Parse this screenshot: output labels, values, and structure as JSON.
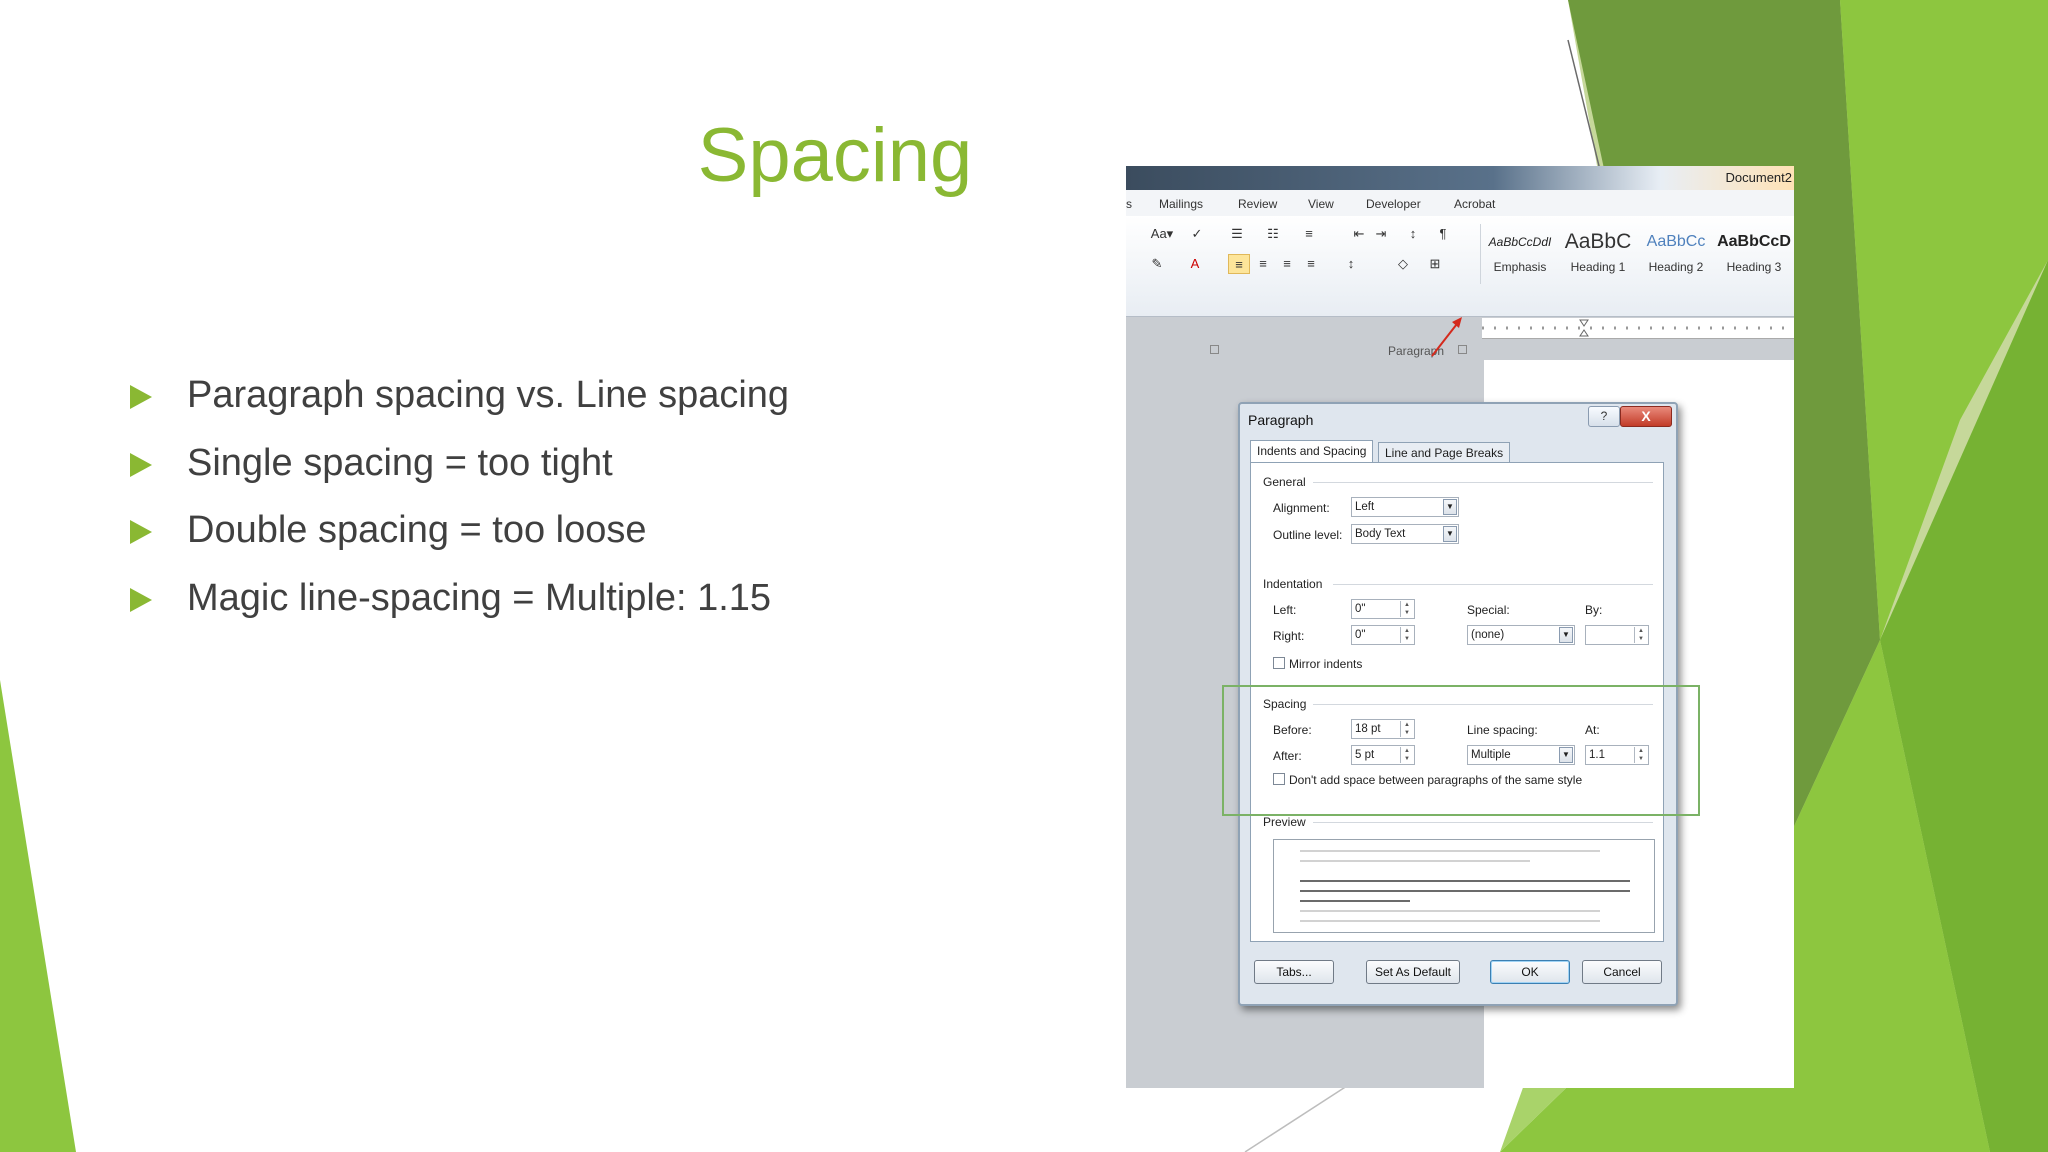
{
  "slide": {
    "title": "Spacing",
    "bullets": [
      "Paragraph spacing vs. Line spacing",
      "Single spacing = too tight",
      "Double spacing = too loose",
      "Magic line-spacing = Multiple: 1.15"
    ],
    "accent_color": "#8ab833",
    "text_color": "#404040"
  },
  "screenshot": {
    "window_title": "Document2",
    "menu": [
      "s",
      "Mailings",
      "Review",
      "View",
      "Developer",
      "Acrobat"
    ],
    "ribbon_group_label": "Paragraph",
    "styles": [
      {
        "sample": "AaBbCcDdI",
        "name": "Emphasis"
      },
      {
        "sample": "AaBbC",
        "name": "Heading 1"
      },
      {
        "sample": "AaBbCc",
        "name": "Heading 2"
      },
      {
        "sample": "AaBbCcD",
        "name": "Heading 3"
      }
    ],
    "dialog": {
      "title": "Paragraph",
      "help": "?",
      "close": "X",
      "tabs": [
        "Indents and Spacing",
        "Line and Page Breaks"
      ],
      "general": {
        "heading": "General",
        "alignment_label": "Alignment:",
        "alignment_value": "Left",
        "outline_label": "Outline level:",
        "outline_value": "Body Text"
      },
      "indentation": {
        "heading": "Indentation",
        "left_label": "Left:",
        "left_value": "0\"",
        "right_label": "Right:",
        "right_value": "0\"",
        "special_label": "Special:",
        "special_value": "(none)",
        "by_label": "By:",
        "by_value": "",
        "mirror_label": "Mirror indents"
      },
      "spacing": {
        "heading": "Spacing",
        "before_label": "Before:",
        "before_value": "18 pt",
        "after_label": "After:",
        "after_value": "5 pt",
        "line_spacing_label": "Line spacing:",
        "line_spacing_value": "Multiple",
        "at_label": "At:",
        "at_value": "1.1",
        "dont_add_label": "Don't add space between paragraphs of the same style"
      },
      "preview_heading": "Preview",
      "buttons": {
        "tabs": "Tabs...",
        "set_default": "Set As Default",
        "ok": "OK",
        "cancel": "Cancel"
      }
    }
  }
}
